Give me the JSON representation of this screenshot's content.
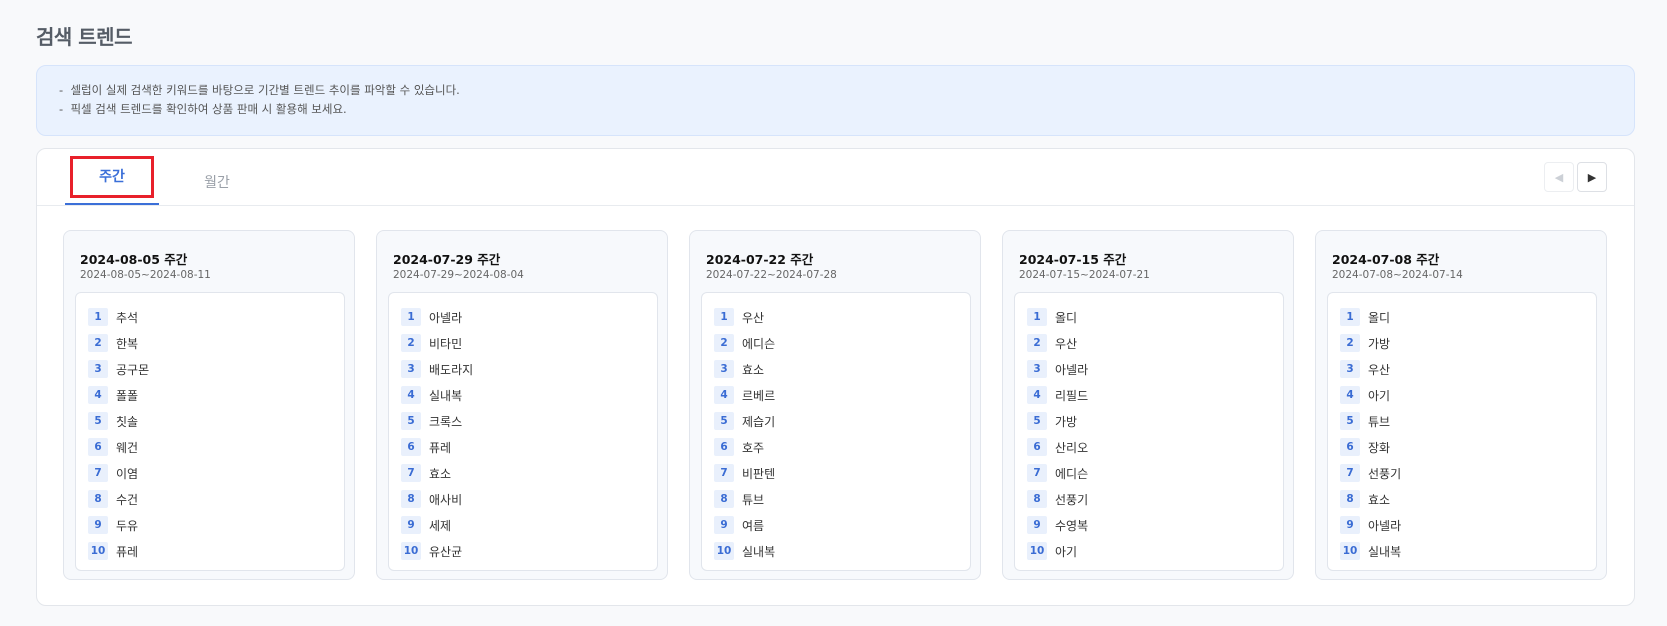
{
  "page": {
    "title": "검색 트렌드"
  },
  "notice": {
    "lines": [
      "셀럽이 실제 검색한 키워드를 바탕으로 기간별 트렌드 추이를 파악할 수 있습니다.",
      "픽셀 검색 트렌드를 확인하여 상품 판매 시 활용해 보세요."
    ]
  },
  "tabs": {
    "weekly": "주간",
    "monthly": "월간",
    "active": "weekly"
  },
  "nav": {
    "prev_icon": "triangle-left-icon",
    "next_icon": "triangle-right-icon",
    "prev_glyph": "◀",
    "next_glyph": "▶"
  },
  "colors": {
    "accent": "#3b6fd8",
    "highlight_box": "#e8202a",
    "rank_badge_bg": "#e9f0fc"
  },
  "weeks": [
    {
      "title": "2024-08-05 주간",
      "range": "2024-08-05~2024-08-11",
      "keywords": [
        "추석",
        "한복",
        "공구몬",
        "폴폴",
        "칫솔",
        "웨건",
        "이염",
        "수건",
        "두유",
        "퓨레"
      ]
    },
    {
      "title": "2024-07-29 주간",
      "range": "2024-07-29~2024-08-04",
      "keywords": [
        "아넬라",
        "비타민",
        "배도라지",
        "실내복",
        "크록스",
        "퓨레",
        "효소",
        "애사비",
        "세제",
        "유산균"
      ]
    },
    {
      "title": "2024-07-22 주간",
      "range": "2024-07-22~2024-07-28",
      "keywords": [
        "우산",
        "에디슨",
        "효소",
        "르베르",
        "제습기",
        "호주",
        "비판텐",
        "튜브",
        "여름",
        "실내복"
      ]
    },
    {
      "title": "2024-07-15 주간",
      "range": "2024-07-15~2024-07-21",
      "keywords": [
        "올디",
        "우산",
        "아넬라",
        "리필드",
        "가방",
        "산리오",
        "에디슨",
        "선풍기",
        "수영복",
        "아기"
      ]
    },
    {
      "title": "2024-07-08 주간",
      "range": "2024-07-08~2024-07-14",
      "keywords": [
        "올디",
        "가방",
        "우산",
        "아기",
        "튜브",
        "장화",
        "선풍기",
        "효소",
        "아넬라",
        "실내복"
      ]
    }
  ]
}
